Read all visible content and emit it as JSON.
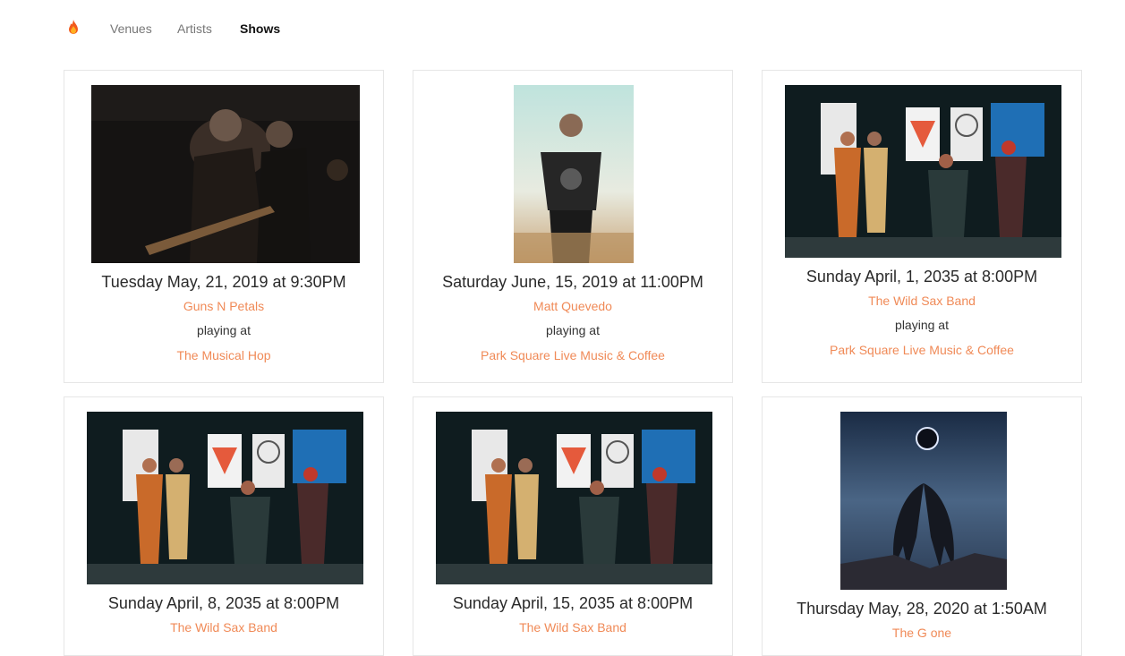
{
  "nav": {
    "logo": "fire-icon",
    "items": [
      "Venues",
      "Artists",
      "Shows"
    ],
    "active": "Shows"
  },
  "shows": [
    {
      "date": "Tuesday May, 21, 2019 at 9:30PM",
      "artist": "Guns N Petals",
      "playing": "playing at",
      "venue": "The Musical Hop"
    },
    {
      "date": "Saturday June, 15, 2019 at 11:00PM",
      "artist": "Matt Quevedo",
      "playing": "playing at",
      "venue": "Park Square Live Music & Coffee"
    },
    {
      "date": "Sunday April, 1, 2035 at 8:00PM",
      "artist": "The Wild Sax Band",
      "playing": "playing at",
      "venue": "Park Square Live Music & Coffee"
    },
    {
      "date": "Sunday April, 8, 2035 at 8:00PM",
      "artist": "The Wild Sax Band"
    },
    {
      "date": "Sunday April, 15, 2035 at 8:00PM",
      "artist": "The Wild Sax Band"
    },
    {
      "date": "Thursday May, 28, 2020 at 1:50AM",
      "artist": "The G one"
    }
  ],
  "colors": {
    "accent": "#f08a57",
    "border": "#e6e6e6"
  }
}
